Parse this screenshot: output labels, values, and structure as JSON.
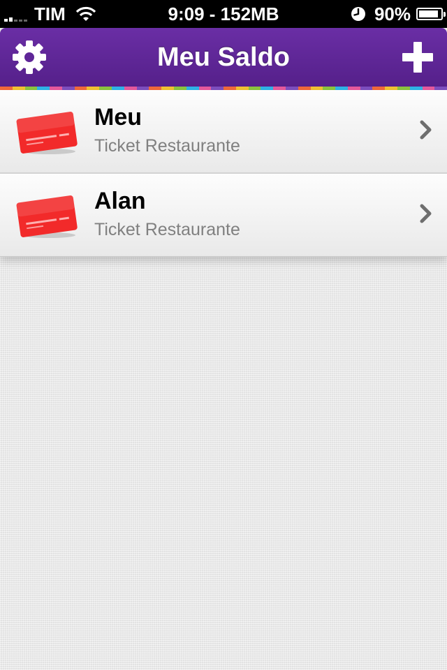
{
  "status_bar": {
    "carrier": "TIM",
    "time_memory": "9:09 - 152MB",
    "battery_percent": "90%",
    "battery_level": 0.9,
    "icons": [
      "signal-icon",
      "wifi-icon",
      "clock-icon",
      "battery-icon"
    ]
  },
  "nav": {
    "title": "Meu Saldo",
    "left_icon": "gear-icon",
    "right_icon": "plus-icon",
    "bar_color": "#5f2698"
  },
  "accent_stripe_colors": [
    "#f26a3a",
    "#f3c432",
    "#8cc63f",
    "#2fb5e8",
    "#e85a9e",
    "#7d4fc0"
  ],
  "cards": [
    {
      "name": "Meu",
      "type": "Ticket Restaurante",
      "icon": "red-card-icon",
      "card_color": "#f22a2a"
    },
    {
      "name": "Alan",
      "type": "Ticket Restaurante",
      "icon": "red-card-icon",
      "card_color": "#f22a2a"
    }
  ]
}
